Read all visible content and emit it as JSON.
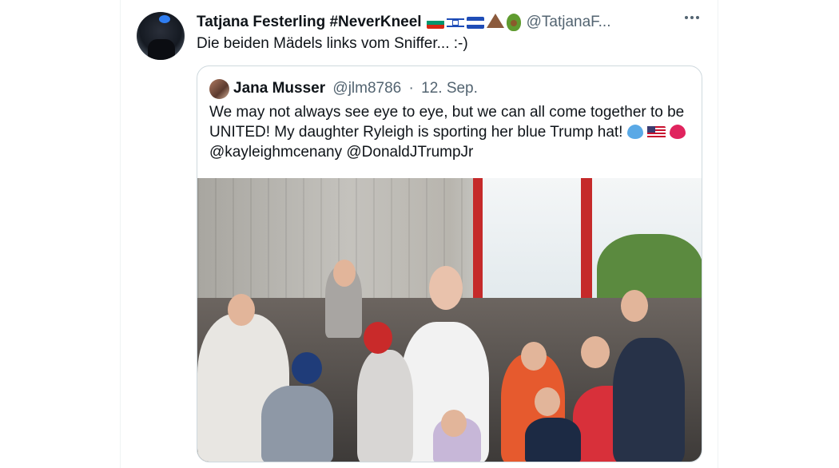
{
  "tweet": {
    "display_name": "Tatjana Festerling #NeverKneel",
    "name_emoji_icons": [
      "flag-bulgaria-icon",
      "flag-israel-icon",
      "flag-el-salvador-icon",
      "volcano-icon",
      "avocado-icon"
    ],
    "handle": "@TatjanaF...",
    "text": "Die beiden Mädels links vom Sniffer... :-)"
  },
  "quoted_tweet": {
    "display_name": "Jana Musser",
    "handle": "@jlm8786",
    "separator": "·",
    "date": "12. Sep.",
    "text_part1": "We may not always see eye to eye, but we can all come together to be UNITED! My daughter Ryleigh is sporting her blue Trump hat!",
    "text_emoji_icons": [
      "blue-heart-icon",
      "us-flag-icon",
      "red-heart-icon"
    ],
    "mentions": "@kayleighmcenany @DonaldJTrumpJr"
  },
  "colors": {
    "text_primary": "#0f1419",
    "text_secondary": "#536471",
    "border": "#cfd9de"
  }
}
